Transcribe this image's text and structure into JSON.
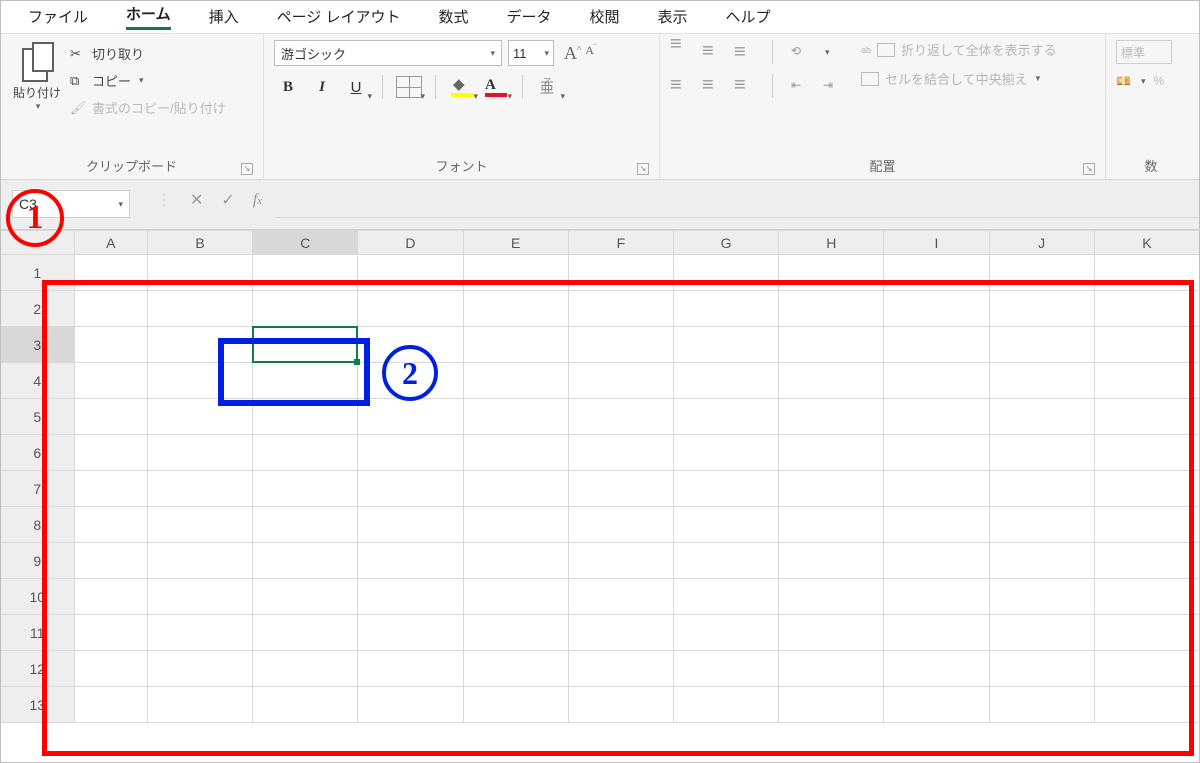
{
  "tabs": {
    "file": "ファイル",
    "home": "ホーム",
    "insert": "挿入",
    "page_layout": "ページ レイアウト",
    "formulas": "数式",
    "data": "データ",
    "review": "校閲",
    "view": "表示",
    "help": "ヘルプ"
  },
  "active_tab": "home",
  "clipboard": {
    "paste": "貼り付け",
    "cut": "切り取り",
    "copy": "コピー",
    "format_painter": "書式のコピー/貼り付け",
    "group_label": "クリップボード"
  },
  "font": {
    "name": "游ゴシック",
    "size": "11",
    "bold": "B",
    "italic": "I",
    "underline": "U",
    "increase": "A",
    "decrease": "A",
    "fontcolor_letter": "A",
    "group_label": "フォント"
  },
  "alignment": {
    "wrap": "折り返して全体を表示する",
    "wrap_prefix": "ab",
    "merge": "セルを結合して中央揃え",
    "group_label": "配置"
  },
  "number": {
    "format": "標準",
    "currency": "%",
    "group_label": "数"
  },
  "name_box": "C3",
  "columns": [
    "A",
    "B",
    "C",
    "D",
    "E",
    "F",
    "G",
    "H",
    "I",
    "J",
    "K"
  ],
  "rows": [
    "1",
    "2",
    "3",
    "4",
    "5",
    "6",
    "7",
    "8",
    "9",
    "10",
    "11",
    "12",
    "13"
  ],
  "selected_cell": {
    "col": "C",
    "row": "3"
  },
  "annotations": {
    "one": "1",
    "two": "2"
  }
}
